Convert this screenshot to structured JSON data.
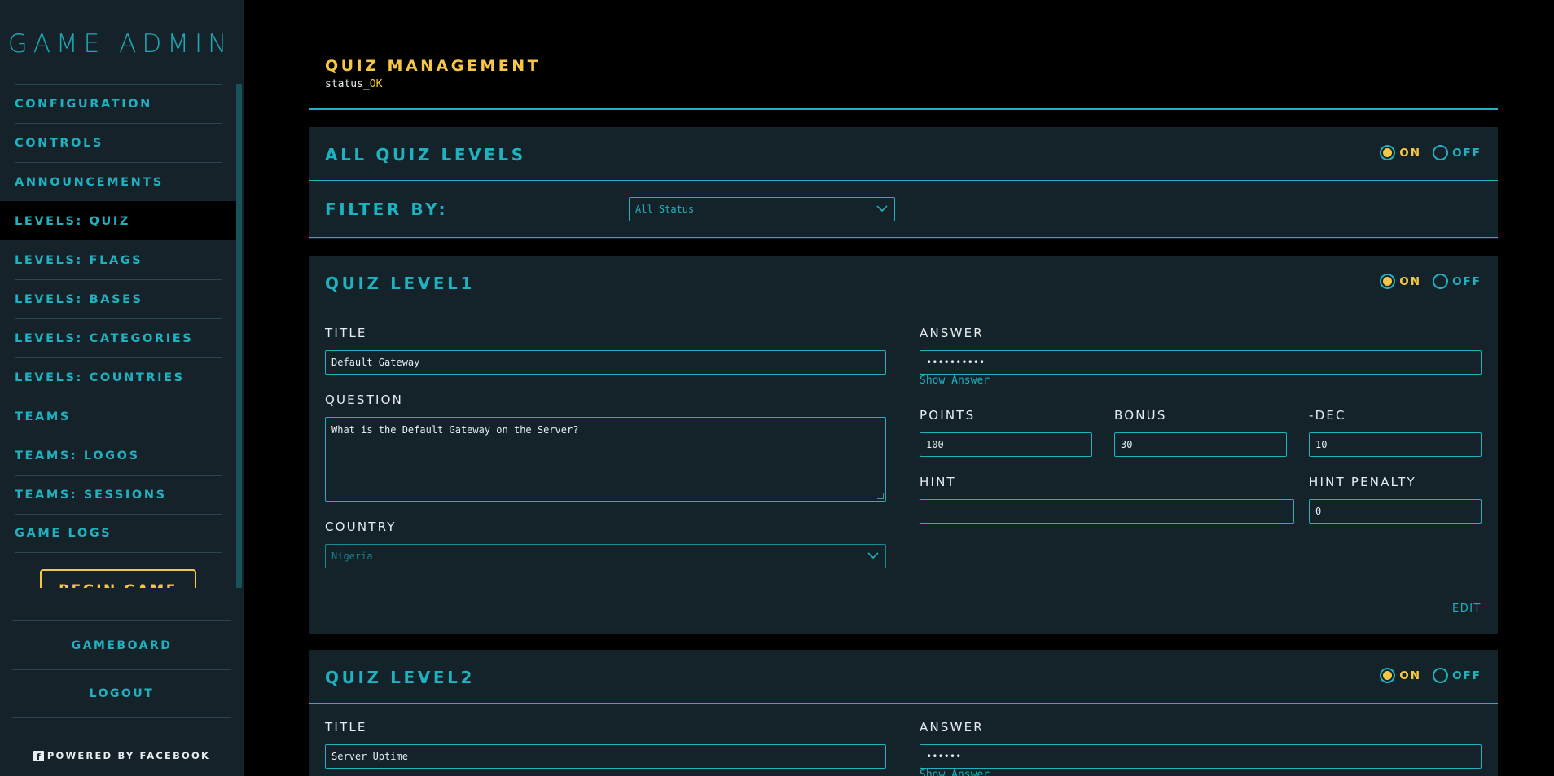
{
  "sidebar": {
    "logo": "GAME ADMIN",
    "items": [
      {
        "label": "CONFIGURATION"
      },
      {
        "label": "CONTROLS"
      },
      {
        "label": "ANNOUNCEMENTS"
      },
      {
        "label": "LEVELS: QUIZ"
      },
      {
        "label": "LEVELS: FLAGS"
      },
      {
        "label": "LEVELS: BASES"
      },
      {
        "label": "LEVELS: CATEGORIES"
      },
      {
        "label": "LEVELS: COUNTRIES"
      },
      {
        "label": "TEAMS"
      },
      {
        "label": "TEAMS: LOGOS"
      },
      {
        "label": "TEAMS: SESSIONS"
      },
      {
        "label": "GAME LOGS"
      }
    ],
    "active_item": "LEVELS: QUIZ",
    "begin_game": "BEGIN GAME",
    "gameboard": "GAMEBOARD",
    "logout": "LOGOUT",
    "powered_by": "POWERED BY FACEBOOK"
  },
  "page": {
    "title": "QUIZ MANAGEMENT",
    "status_prefix": "status_",
    "status_value": "OK"
  },
  "all_levels": {
    "title": "ALL QUIZ LEVELS",
    "toggle_on": "ON",
    "toggle_off": "OFF",
    "selected": "ON",
    "filter_label": "FILTER BY:",
    "filter_value": "All Status"
  },
  "levels": [
    {
      "title": "QUIZ LEVEL1",
      "toggle_on": "ON",
      "toggle_off": "OFF",
      "selected": "ON",
      "title_label": "TITLE",
      "title_value": "Default Gateway",
      "question_label": "QUESTION",
      "question_value": "What is the Default Gateway on the Server?",
      "country_label": "COUNTRY",
      "country_value": "Nigeria",
      "answer_label": "ANSWER",
      "answer_value": "••••••••••",
      "show_answer": "Show Answer",
      "points_label": "POINTS",
      "points_value": "100",
      "bonus_label": "BONUS",
      "bonus_value": "30",
      "dec_label": "-DEC",
      "dec_value": "10",
      "hint_label": "HINT",
      "hint_value": "",
      "hint_penalty_label": "HINT PENALTY",
      "hint_penalty_value": "0",
      "edit": "EDIT"
    },
    {
      "title": "QUIZ LEVEL2",
      "toggle_on": "ON",
      "toggle_off": "OFF",
      "selected": "ON",
      "title_label": "TITLE",
      "title_value": "Server Uptime",
      "answer_label": "ANSWER",
      "answer_value": "••••••",
      "show_answer": "Show Answer"
    }
  ],
  "colors": {
    "accent": "#1fb1bf",
    "highlight": "#f5c742",
    "panel": "#14232a",
    "sidebar": "#15222a"
  }
}
